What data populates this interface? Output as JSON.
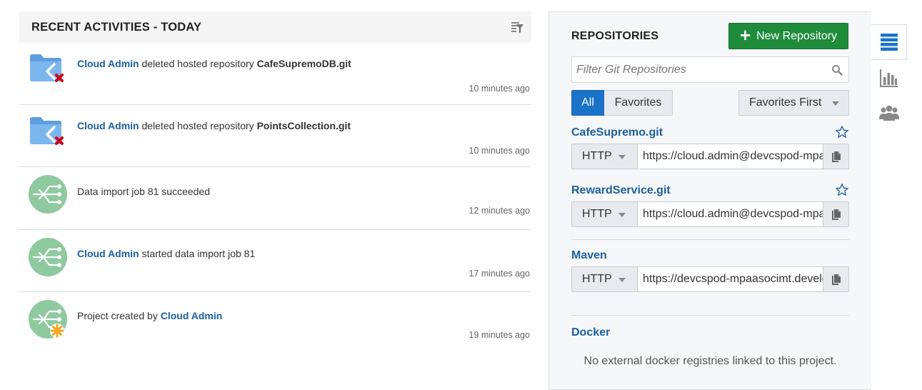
{
  "activities": {
    "title": "RECENT ACTIVITIES - TODAY",
    "items": [
      {
        "icon": "folder-deleted-icon",
        "parts": [
          {
            "text": "Cloud Admin",
            "kind": "user"
          },
          {
            "text": " deleted hosted repository ",
            "kind": "plain"
          },
          {
            "text": "CafeSupremoDB.git",
            "kind": "target"
          }
        ],
        "time": "10 minutes ago"
      },
      {
        "icon": "folder-deleted-icon",
        "parts": [
          {
            "text": "Cloud Admin",
            "kind": "user"
          },
          {
            "text": " deleted hosted repository ",
            "kind": "plain"
          },
          {
            "text": "PointsCollection.git",
            "kind": "target"
          }
        ],
        "time": "10 minutes ago"
      },
      {
        "icon": "data-import-icon",
        "parts": [
          {
            "text": "Data import job 81 succeeded",
            "kind": "plain"
          }
        ],
        "time": "12 minutes ago"
      },
      {
        "icon": "data-import-icon",
        "parts": [
          {
            "text": "Cloud Admin",
            "kind": "user"
          },
          {
            "text": " started data import job 81",
            "kind": "plain"
          }
        ],
        "time": "17 minutes ago"
      },
      {
        "icon": "project-created-icon",
        "parts": [
          {
            "text": "Project created by ",
            "kind": "plain"
          },
          {
            "text": "Cloud Admin",
            "kind": "user"
          }
        ],
        "time": "19 minutes ago"
      }
    ]
  },
  "repositories": {
    "title": "REPOSITORIES",
    "new_button": "New Repository",
    "filter_placeholder": "Filter Git Repositories",
    "segments": {
      "all": "All",
      "favorites": "Favorites",
      "selected": "All"
    },
    "sort": "Favorites First",
    "items": [
      {
        "name": "CafeSupremo.git",
        "protocol": "HTTP",
        "url": "https://cloud.admin@devcspod-mpaasocimt.developer.ocp.oraclecloud.com",
        "starred": false
      },
      {
        "name": "RewardService.git",
        "protocol": "HTTP",
        "url": "https://cloud.admin@devcspod-mpaasocimt.developer.ocp.oraclecloud.com",
        "starred": false
      }
    ],
    "maven": {
      "name": "Maven",
      "protocol": "HTTP",
      "url": "https://devcspod-mpaasocimt.developer.ocp.oraclecloud.com"
    },
    "docker": {
      "name": "Docker",
      "empty_text": "No external docker registries linked to this project."
    }
  },
  "colors": {
    "link": "#1a5f9e",
    "primary": "#1a72c9",
    "success": "#1f8c3b",
    "tile_green": "#8fc9a0"
  }
}
